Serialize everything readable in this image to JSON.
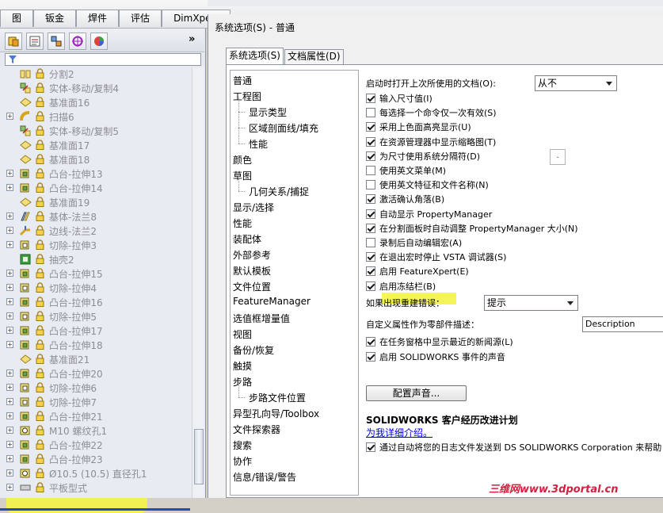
{
  "top_tabs": [
    "图",
    "钣金",
    "焊件",
    "评估",
    "DimXpert"
  ],
  "tree_items": [
    {
      "label": "分割2",
      "icon": "split-icon",
      "expandable": false
    },
    {
      "label": "实体-移动/复制4",
      "icon": "move-copy-icon",
      "expandable": false
    },
    {
      "label": "基准面16",
      "icon": "plane-icon",
      "expandable": false
    },
    {
      "label": "扫描6",
      "icon": "sweep-icon",
      "expandable": true
    },
    {
      "label": "实体-移动/复制5",
      "icon": "move-copy-icon",
      "expandable": false
    },
    {
      "label": "基准面17",
      "icon": "plane-icon",
      "expandable": false
    },
    {
      "label": "基准面18",
      "icon": "plane-icon",
      "expandable": false
    },
    {
      "label": "凸台-拉伸13",
      "icon": "boss-extrude-icon",
      "expandable": true
    },
    {
      "label": "凸台-拉伸14",
      "icon": "boss-extrude-icon",
      "expandable": true
    },
    {
      "label": "基准面19",
      "icon": "plane-icon",
      "expandable": false
    },
    {
      "label": "基体-法兰8",
      "icon": "base-flange-icon",
      "expandable": true
    },
    {
      "label": "边线-法兰2",
      "icon": "edge-flange-icon",
      "expandable": true
    },
    {
      "label": "切除-拉伸3",
      "icon": "cut-extrude-icon",
      "expandable": true
    },
    {
      "label": "抽壳2",
      "icon": "shell-icon",
      "expandable": false
    },
    {
      "label": "凸台-拉伸15",
      "icon": "boss-extrude-icon",
      "expandable": true
    },
    {
      "label": "切除-拉伸4",
      "icon": "cut-extrude-icon",
      "expandable": true
    },
    {
      "label": "凸台-拉伸16",
      "icon": "boss-extrude-icon",
      "expandable": true
    },
    {
      "label": "切除-拉伸5",
      "icon": "cut-extrude-icon",
      "expandable": true
    },
    {
      "label": "凸台-拉伸17",
      "icon": "boss-extrude-icon",
      "expandable": true
    },
    {
      "label": "凸台-拉伸18",
      "icon": "boss-extrude-icon",
      "expandable": true
    },
    {
      "label": "基准面21",
      "icon": "plane-icon",
      "expandable": false
    },
    {
      "label": "凸台-拉伸20",
      "icon": "boss-extrude-icon",
      "expandable": true
    },
    {
      "label": "切除-拉伸6",
      "icon": "cut-extrude-icon",
      "expandable": true
    },
    {
      "label": "切除-拉伸7",
      "icon": "cut-extrude-icon",
      "expandable": true
    },
    {
      "label": "凸台-拉伸21",
      "icon": "boss-extrude-icon",
      "expandable": true
    },
    {
      "label": "M10 螺纹孔1",
      "icon": "hole-icon",
      "expandable": true
    },
    {
      "label": "凸台-拉伸22",
      "icon": "boss-extrude-icon",
      "expandable": true
    },
    {
      "label": "凸台-拉伸23",
      "icon": "boss-extrude-icon",
      "expandable": true
    },
    {
      "label": "Ø10.5 (10.5) 直径孔1",
      "icon": "hole-icon",
      "expandable": true
    },
    {
      "label": "平板型式",
      "icon": "flat-pattern-icon",
      "expandable": true
    }
  ],
  "dialog": {
    "title": "系统选项(S) - 普通",
    "tabs": [
      "系统选项(S)",
      "文档属性(D)"
    ],
    "categories": [
      {
        "label": "普通",
        "indent": 0
      },
      {
        "label": "工程图",
        "indent": 0
      },
      {
        "label": "显示类型",
        "indent": 1
      },
      {
        "label": "区域剖面线/填充",
        "indent": 1
      },
      {
        "label": "性能",
        "indent": 1
      },
      {
        "label": "颜色",
        "indent": 0
      },
      {
        "label": "草图",
        "indent": 0
      },
      {
        "label": "几何关系/捕捉",
        "indent": 1
      },
      {
        "label": "显示/选择",
        "indent": 0
      },
      {
        "label": "性能",
        "indent": 0
      },
      {
        "label": "装配体",
        "indent": 0
      },
      {
        "label": "外部参考",
        "indent": 0
      },
      {
        "label": "默认模板",
        "indent": 0
      },
      {
        "label": "文件位置",
        "indent": 0
      },
      {
        "label": "FeatureManager",
        "indent": 0
      },
      {
        "label": "选值框增量值",
        "indent": 0
      },
      {
        "label": "视图",
        "indent": 0
      },
      {
        "label": "备份/恢复",
        "indent": 0
      },
      {
        "label": "触摸",
        "indent": 0
      },
      {
        "label": "步路",
        "indent": 0
      },
      {
        "label": "步路文件位置",
        "indent": 1
      },
      {
        "label": "异型孔向导/Toolbox",
        "indent": 0
      },
      {
        "label": "文件探索器",
        "indent": 0
      },
      {
        "label": "搜索",
        "indent": 0
      },
      {
        "label": "协作",
        "indent": 0
      },
      {
        "label": "信息/错误/警告",
        "indent": 0
      }
    ],
    "open_last_label": "启动时打开上次所使用的文档(O):",
    "open_last_value": "从不",
    "checkboxes": [
      {
        "label": "输入尺寸值(I)",
        "checked": true
      },
      {
        "label": "每选择一个命令仅一次有效(S)",
        "checked": false
      },
      {
        "label": "采用上色面高亮显示(U)",
        "checked": true
      },
      {
        "label": "在资源管理器中显示缩略图(T)",
        "checked": true
      },
      {
        "label": "为尺寸使用系统分隔符(D)",
        "checked": true
      },
      {
        "label": "使用英文菜单(M)",
        "checked": false
      },
      {
        "label": "使用英文特征和文件名称(N)",
        "checked": false
      },
      {
        "label": "激活确认角落(B)",
        "checked": true
      },
      {
        "label": "自动显示 PropertyManager",
        "checked": true
      },
      {
        "label": "在分割面板时自动调整 PropertyManager 大小(N)",
        "checked": true
      },
      {
        "label": "录制后自动编辑宏(A)",
        "checked": false
      },
      {
        "label": "在退出宏时停止 VSTA 调试器(S)",
        "checked": true
      },
      {
        "label": "启用 FeatureXpert(E)",
        "checked": true
      },
      {
        "label": "启用冻结栏(B)",
        "checked": true
      }
    ],
    "separator_value": ".",
    "rebuild_error_label": "如果出现重建错误：",
    "rebuild_error_value": "提示",
    "custom_prop_label": "自定义属性作为零部件描述：",
    "custom_prop_value": "Description",
    "checkboxes2": [
      {
        "label": "在任务窗格中显示最近的新闻源(L)",
        "checked": true
      },
      {
        "label": "启用 SOLIDWORKS 事件的声音",
        "checked": true
      }
    ],
    "sound_button": "配置声音...",
    "ceip_title": "SOLIDWORKS 客户经历改进计划",
    "ceip_link": "为我详细介绍。",
    "ceip_checkbox": {
      "label": "通过自动将您的日志文件发送到 DS SOLIDWORKS Corporation 来帮助",
      "checked": true
    }
  },
  "watermark": "三维网www.3dportal.cn",
  "colors": {
    "highlight": "#f7f73f",
    "link": "#0000ee",
    "watermark": "#d3203f",
    "selection_line": "#1f4fb4"
  }
}
